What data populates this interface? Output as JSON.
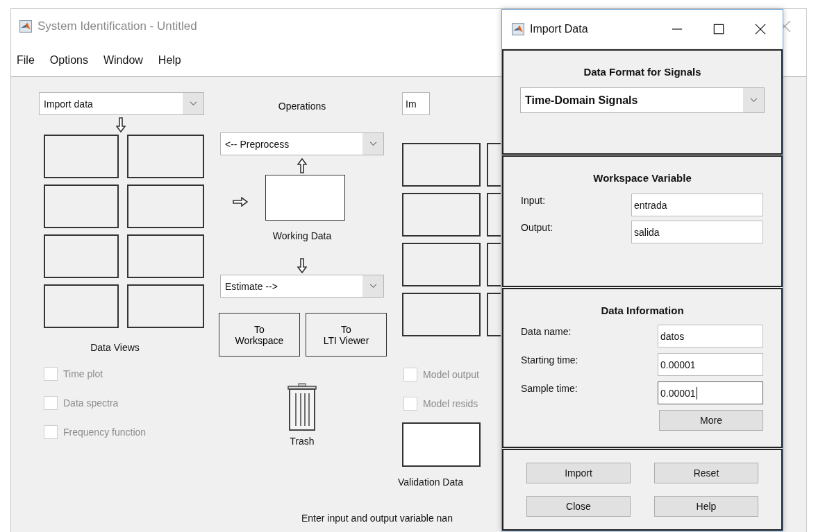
{
  "main_window": {
    "title": "System Identification - Untitled",
    "menu": [
      {
        "label": "File"
      },
      {
        "label": "Options"
      },
      {
        "label": "Window"
      },
      {
        "label": "Help"
      }
    ],
    "data_dropdown": {
      "value": "Import data"
    },
    "data_views_label": "Data Views",
    "data_view_checks": [
      {
        "label": "Time plot",
        "checked": false,
        "disabled": true
      },
      {
        "label": "Data spectra",
        "checked": false,
        "disabled": true
      },
      {
        "label": "Frequency function",
        "checked": false,
        "disabled": true
      }
    ],
    "operations_label": "Operations",
    "preprocess_dropdown": {
      "value": "<-- Preprocess"
    },
    "working_data_label": "Working Data",
    "estimate_dropdown": {
      "value": "Estimate -->"
    },
    "export_buttons": [
      "To\nWorkspace",
      "To\nLTI Viewer"
    ],
    "trash_label": "Trash",
    "model_dropdown": {
      "value": "Im"
    },
    "model_view_checks": [
      {
        "label": "Model output",
        "checked": false,
        "disabled": true
      },
      {
        "label": "Model resids",
        "checked": false,
        "disabled": true
      }
    ],
    "validation_label": "Validation Data",
    "status": "Enter input and output variable nan"
  },
  "dialog": {
    "title": "Import Data",
    "format_panel": {
      "title": "Data Format for Signals",
      "value": "Time-Domain Signals"
    },
    "workspace_panel": {
      "title": "Workspace Variable",
      "fields": [
        {
          "label": "Input:",
          "value": "entrada",
          "focused": false
        },
        {
          "label": "Output:",
          "value": "salida",
          "focused": false
        }
      ]
    },
    "info_panel": {
      "title": "Data Information",
      "fields": [
        {
          "label": "Data name:",
          "value": "datos",
          "focused": false
        },
        {
          "label": "Starting time:",
          "value": "0.00001",
          "focused": false
        },
        {
          "label": "Sample time:",
          "value": "0.00001",
          "focused": true
        }
      ],
      "more_button": "More"
    },
    "buttons": [
      "Import",
      "Reset",
      "Close",
      "Help"
    ]
  }
}
